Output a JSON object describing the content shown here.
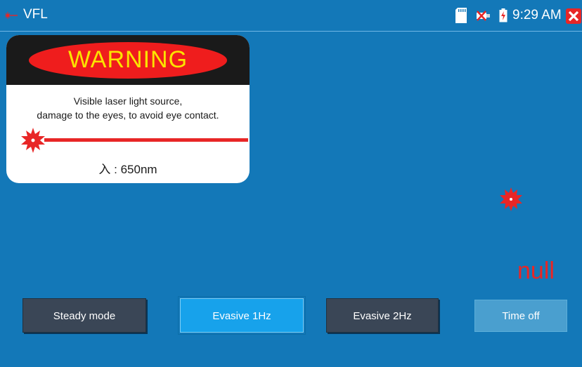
{
  "header": {
    "app_title": "VFL",
    "time": "9:29 AM",
    "icons": [
      "laser-icon",
      "sd-card-icon",
      "usb-icon",
      "battery-charging-icon",
      "close-icon"
    ]
  },
  "warning": {
    "title": "WARNING",
    "message_line1": "Visible laser light source,",
    "message_line2": "damage to the eyes, to avoid eye contact.",
    "wavelength": "入 : 650nm"
  },
  "status": {
    "value": "null"
  },
  "buttons": {
    "steady": "Steady mode",
    "evasive_1hz": "Evasive 1Hz",
    "evasive_2hz": "Evasive 2Hz",
    "time_off": "Time off",
    "selected": "evasive_1hz"
  },
  "colors": {
    "background": "#1378b8",
    "laser_red": "#e82626",
    "warning_yellow": "#fbe400",
    "button_dark": "#3a4656",
    "button_active": "#17a2eb"
  }
}
